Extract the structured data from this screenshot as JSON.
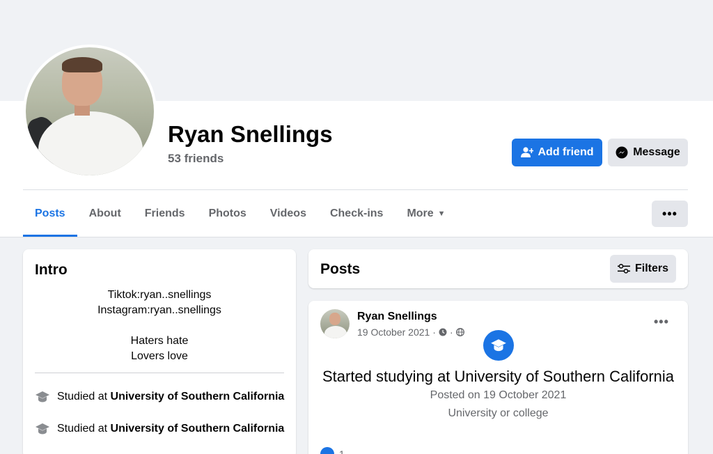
{
  "profile": {
    "name": "Ryan Snellings",
    "friends_count": "53 friends"
  },
  "actions": {
    "add_friend": "Add friend",
    "message": "Message",
    "more_dots": "•••"
  },
  "tabs": [
    {
      "label": "Posts",
      "active": true
    },
    {
      "label": "About"
    },
    {
      "label": "Friends"
    },
    {
      "label": "Photos"
    },
    {
      "label": "Videos"
    },
    {
      "label": "Check-ins"
    },
    {
      "label": "More"
    }
  ],
  "intro": {
    "title": "Intro",
    "bio_lines": [
      "Tiktok:ryan..snellings",
      "Instagram:ryan..snellings",
      "Haters hate",
      "Lovers love"
    ],
    "education": [
      {
        "prefix": "Studied at",
        "school": "University of Southern California"
      },
      {
        "prefix": "Studied at",
        "school": "University of Southern California"
      }
    ]
  },
  "posts_section": {
    "title": "Posts",
    "filters_label": "Filters"
  },
  "post": {
    "author": "Ryan Snellings",
    "date": "19 October 2021",
    "meta_sep": "·",
    "more_dots": "•••",
    "headline": "Started studying at University of Southern California",
    "posted_on": "Posted on 19 October 2021",
    "category": "University or college",
    "reactions": "1"
  },
  "colors": {
    "accent": "#1b74e4",
    "background": "#f0f2f5",
    "secondary_text": "#65676b"
  }
}
